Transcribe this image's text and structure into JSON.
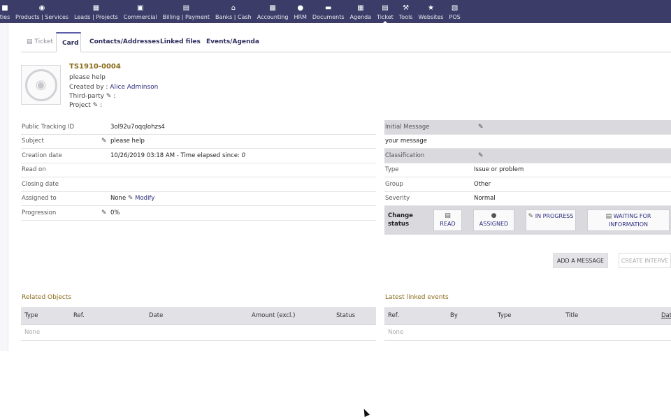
{
  "nav": {
    "items": [
      {
        "label": "ties",
        "icon": "company-icon"
      },
      {
        "label": "Products | Services",
        "icon": "cube-icon"
      },
      {
        "label": "Leads | Projects",
        "icon": "sitemap-icon"
      },
      {
        "label": "Commercial",
        "icon": "suitcase-icon"
      },
      {
        "label": "Billing | Payment",
        "icon": "money-icon"
      },
      {
        "label": "Banks | Cash",
        "icon": "bank-icon"
      },
      {
        "label": "Accounting",
        "icon": "keyboard-icon"
      },
      {
        "label": "HRM",
        "icon": "user-tie-icon"
      },
      {
        "label": "Documents",
        "icon": "folder-icon"
      },
      {
        "label": "Agenda",
        "icon": "calendar-icon"
      },
      {
        "label": "Ticket",
        "icon": "ticket-icon"
      },
      {
        "label": "Tools",
        "icon": "wrench-icon"
      },
      {
        "label": "Websites",
        "icon": "network-icon"
      },
      {
        "label": "POS",
        "icon": "cashdesk-icon"
      }
    ]
  },
  "tabs": {
    "ticket": "Ticket",
    "card": "Card",
    "contacts": "Contacts/Addresses",
    "files": "Linked files",
    "events": "Events/Agenda"
  },
  "header": {
    "ref": "TS1910-0004",
    "subject": "please help",
    "created_by_label": "Created by :",
    "created_by_value": "Alice Adminson",
    "third_party_label": "Third-party",
    "project_label": "Project"
  },
  "fields": {
    "tracking_label": "Public Tracking ID",
    "tracking_value": "3ol92u7oqqlohzs4",
    "subject_label": "Subject",
    "subject_value": "please help",
    "creation_label": "Creation date",
    "creation_value": "10/26/2019 03:18 AM - Time elapsed since: ",
    "creation_elapsed": "0",
    "read_label": "Read on",
    "closing_label": "Closing date",
    "assigned_label": "Assigned to",
    "assigned_value": "None",
    "modify_label": "Modify",
    "progress_label": "Progression",
    "progress_value": "0%"
  },
  "right": {
    "initial_message_label": "Initial Message",
    "initial_message_value": "your message",
    "classification_label": "Classification",
    "type_label": "Type",
    "type_value": "Issue or problem",
    "group_label": "Group",
    "group_value": "Other",
    "severity_label": "Severity",
    "severity_value": "Normal",
    "change_status_label": "Change status",
    "status_buttons": {
      "read": "READ",
      "assigned": "ASSIGNED",
      "in_progress": "IN PROGRESS",
      "waiting": "WAITING FOR INFORMATION"
    }
  },
  "actions": {
    "add_message": "ADD A MESSAGE",
    "create_intervention": "CREATE INTERVE"
  },
  "related": {
    "title": "Related Objects",
    "columns": [
      "Type",
      "Ref.",
      "Date",
      "Amount (excl.)",
      "Status"
    ],
    "empty": "None"
  },
  "events": {
    "title": "Latest linked events",
    "columns": [
      "Ref.",
      "By",
      "Type",
      "Title",
      "Dat"
    ],
    "empty": "None"
  },
  "colors": {
    "nav_bg": "#3b3d68",
    "accent_title": "#8a6a1a",
    "link": "#2b2d7c"
  }
}
